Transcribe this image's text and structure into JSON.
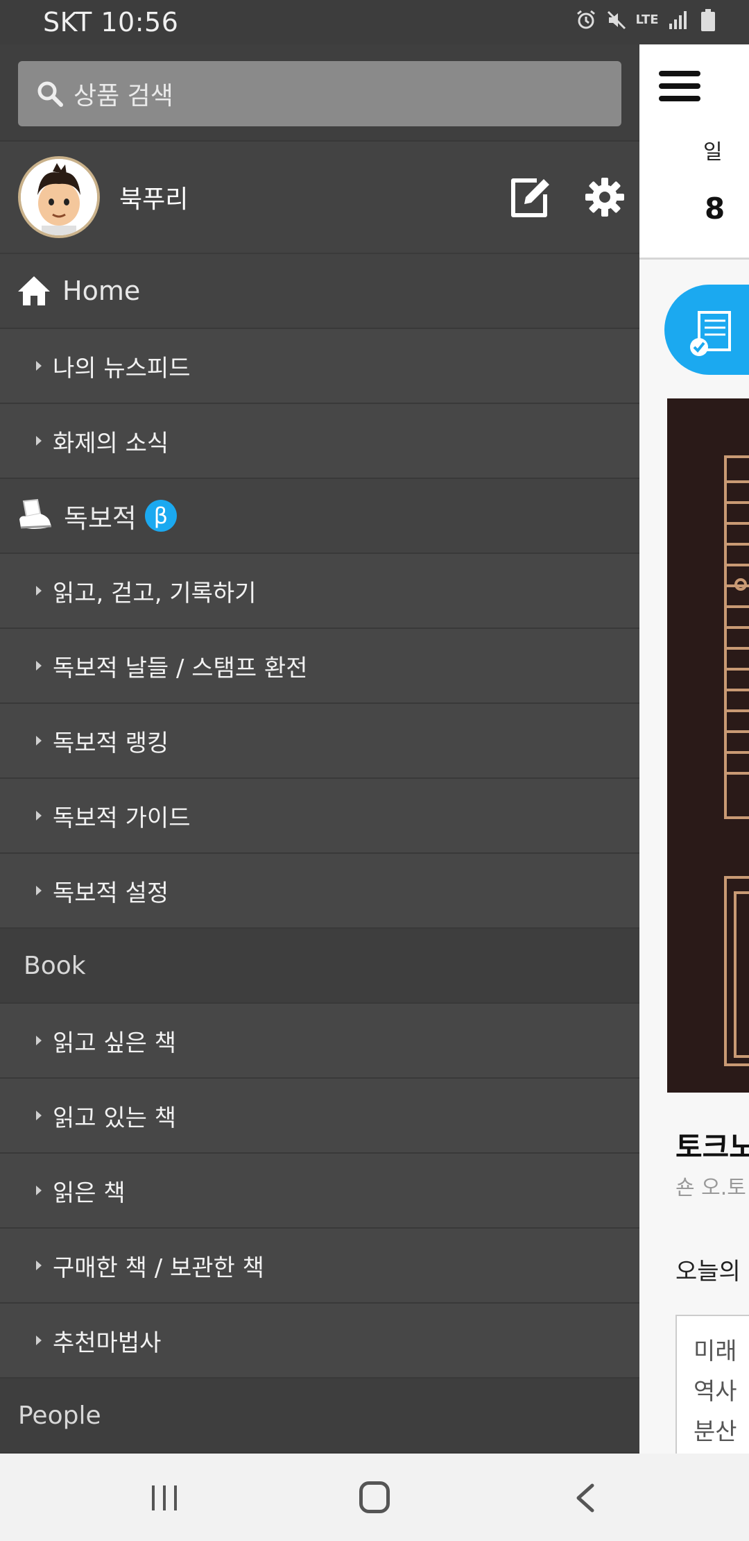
{
  "status_bar": {
    "carrier_time": "SKT 10:56",
    "network": "LTE",
    "icons": [
      "alarm-icon",
      "mute-icon",
      "lte-icon",
      "signal-icon",
      "battery-icon"
    ]
  },
  "drawer": {
    "search_placeholder": "상품 검색",
    "profile": {
      "name": "북푸리"
    },
    "home_label": "Home",
    "home_items": [
      "나의 뉴스피드",
      "화제의 소식"
    ],
    "dokbojeok_label": "독보적",
    "beta_badge": "β",
    "dokbojeok_items": [
      "읽고, 걷고, 기록하기",
      "독보적 날들 / 스탬프 환전",
      "독보적 랭킹",
      "독보적 가이드",
      "독보적 설정"
    ],
    "book_header": "Book",
    "book_items": [
      "읽고 싶은 책",
      "읽고 있는 책",
      "읽은 책",
      "구매한 책 / 보관한 책",
      "추천마법사"
    ],
    "people_header": "People"
  },
  "background_app": {
    "day_label": "일",
    "date": "8",
    "book_title": "토크노",
    "book_author": "숀 오.토",
    "today_label": "오늘의",
    "quote_lines": [
      "미래",
      "역사",
      "분산"
    ]
  },
  "colors": {
    "drawer_bg": "#474747",
    "accent_blue": "#1ba9f0",
    "app_bg": "#f7f7f7"
  }
}
